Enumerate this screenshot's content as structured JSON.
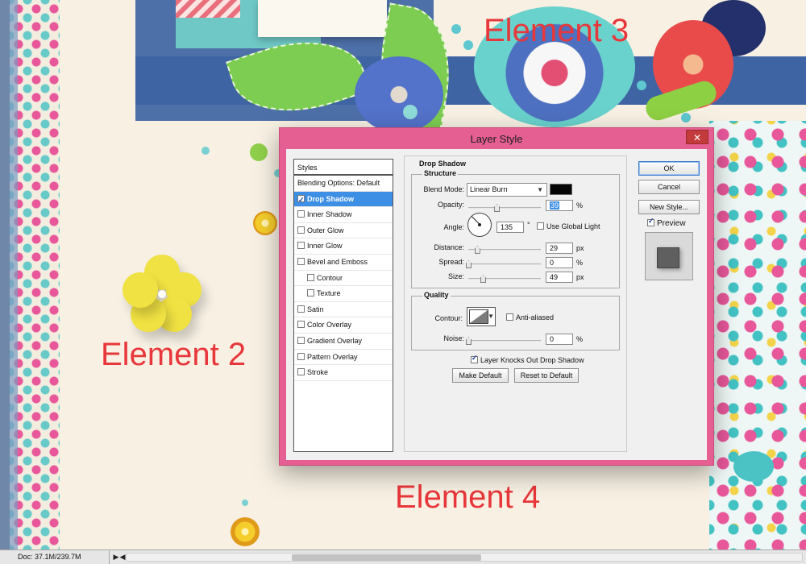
{
  "canvas": {
    "label_element_2": "Element 2",
    "label_element_3": "Element 3",
    "label_element_4": "Element 4",
    "label_color": "#e8373a"
  },
  "dialog": {
    "title": "Layer Style",
    "close_icon": "close-icon",
    "accent_color": "#e55f93"
  },
  "styles_panel": {
    "header": "Styles",
    "items": [
      {
        "label": "Blending Options: Default",
        "checkbox": false,
        "checked": false,
        "selected": false,
        "indent": false
      },
      {
        "label": "Drop Shadow",
        "checkbox": true,
        "checked": true,
        "selected": true,
        "indent": false
      },
      {
        "label": "Inner Shadow",
        "checkbox": true,
        "checked": false,
        "selected": false,
        "indent": false
      },
      {
        "label": "Outer Glow",
        "checkbox": true,
        "checked": false,
        "selected": false,
        "indent": false
      },
      {
        "label": "Inner Glow",
        "checkbox": true,
        "checked": false,
        "selected": false,
        "indent": false
      },
      {
        "label": "Bevel and Emboss",
        "checkbox": true,
        "checked": false,
        "selected": false,
        "indent": false
      },
      {
        "label": "Contour",
        "checkbox": true,
        "checked": false,
        "selected": false,
        "indent": true
      },
      {
        "label": "Texture",
        "checkbox": true,
        "checked": false,
        "selected": false,
        "indent": true
      },
      {
        "label": "Satin",
        "checkbox": true,
        "checked": false,
        "selected": false,
        "indent": false
      },
      {
        "label": "Color Overlay",
        "checkbox": true,
        "checked": false,
        "selected": false,
        "indent": false
      },
      {
        "label": "Gradient Overlay",
        "checkbox": true,
        "checked": false,
        "selected": false,
        "indent": false
      },
      {
        "label": "Pattern Overlay",
        "checkbox": true,
        "checked": false,
        "selected": false,
        "indent": false
      },
      {
        "label": "Stroke",
        "checkbox": true,
        "checked": false,
        "selected": false,
        "indent": false
      }
    ]
  },
  "drop_shadow": {
    "section_title": "Drop Shadow",
    "structure": {
      "title": "Structure",
      "blend_mode_label": "Blend Mode:",
      "blend_mode_value": "Linear Burn",
      "shadow_color": "#050505",
      "opacity_label": "Opacity:",
      "opacity_value": "39",
      "opacity_unit": "%",
      "opacity_level": 0.39,
      "angle_label": "Angle:",
      "angle_value": "135",
      "angle_unit": "°",
      "angle_degrees": 135,
      "use_global_light_label": "Use Global Light",
      "use_global_light": false,
      "distance_label": "Distance:",
      "distance_value": "29",
      "distance_unit": "px",
      "distance_level": 0.12,
      "spread_label": "Spread:",
      "spread_value": "0",
      "spread_unit": "%",
      "spread_level": 0,
      "size_label": "Size:",
      "size_value": "49",
      "size_unit": "px",
      "size_level": 0.2
    },
    "quality": {
      "title": "Quality",
      "contour_label": "Contour:",
      "anti_aliased_label": "Anti-aliased",
      "anti_aliased": false,
      "noise_label": "Noise:",
      "noise_value": "0",
      "noise_unit": "%",
      "noise_level": 0
    },
    "knocks_out_label": "Layer Knocks Out Drop Shadow",
    "knocks_out": true,
    "make_default_label": "Make Default",
    "reset_default_label": "Reset to Default"
  },
  "actions": {
    "ok_label": "OK",
    "cancel_label": "Cancel",
    "new_style_label": "New Style...",
    "preview_label": "Preview",
    "preview_checked": true
  },
  "statusbar": {
    "doc_info": "Doc: 37.1M/239.7M"
  }
}
